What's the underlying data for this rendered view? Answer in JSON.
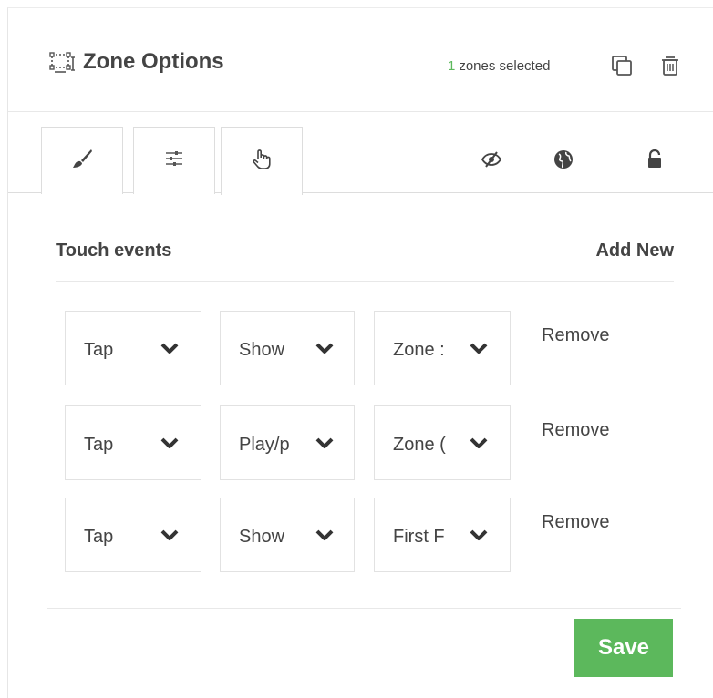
{
  "header": {
    "title": "Zone Options",
    "selected_count": "1",
    "selected_text": "zones selected",
    "icon": "zone-select-icon"
  },
  "tabs": [
    {
      "icon": "paintbrush-icon"
    },
    {
      "icon": "sliders-icon"
    },
    {
      "icon": "hand-pointer-icon",
      "active": true
    }
  ],
  "toolbar": {
    "icons": [
      "eye-slash-icon",
      "globe-icon",
      "unlock-icon"
    ]
  },
  "touch_events": {
    "title": "Touch events",
    "add_new_label": "Add New",
    "rows": [
      {
        "trigger": "Tap",
        "action": "Show",
        "target": "Zone :",
        "remove_label": "Remove"
      },
      {
        "trigger": "Tap",
        "action": "Play/p",
        "target": "Zone (",
        "remove_label": "Remove"
      },
      {
        "trigger": "Tap",
        "action": "Show",
        "target": "First F",
        "remove_label": "Remove"
      }
    ]
  },
  "footer": {
    "save_label": "Save"
  },
  "colors": {
    "accent": "#5cb85c",
    "text": "#444444",
    "border": "#e2e2e2"
  }
}
